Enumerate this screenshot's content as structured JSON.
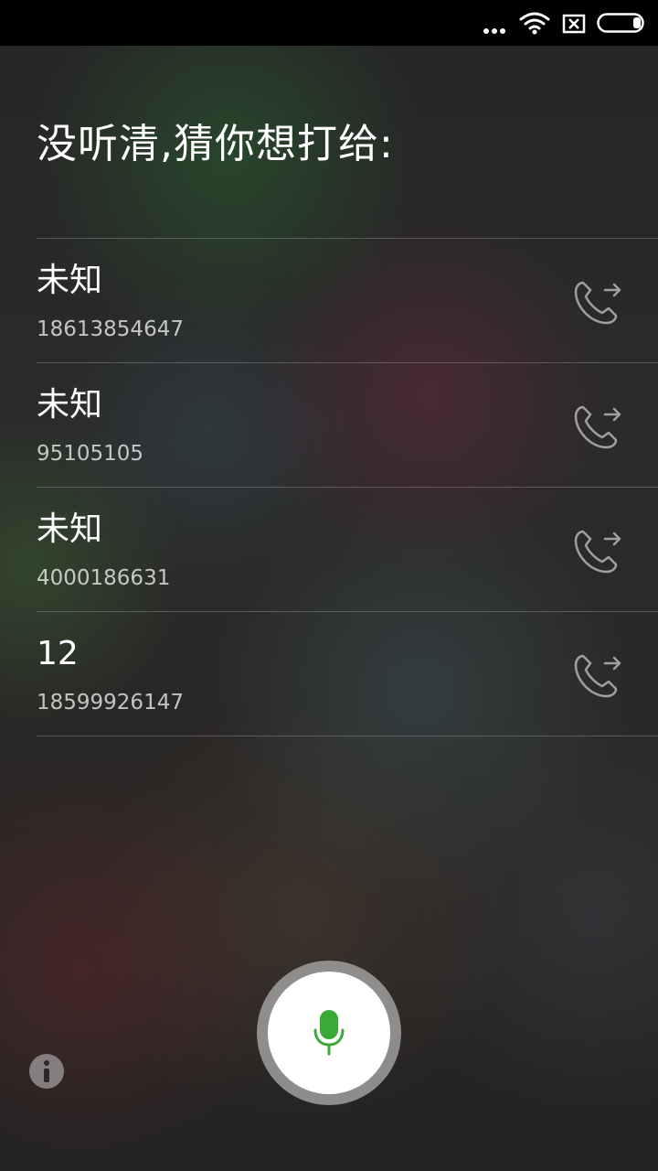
{
  "status_bar": {
    "icons": [
      "more-dots-icon",
      "wifi-icon",
      "no-sim-icon",
      "battery-icon"
    ]
  },
  "prompt": {
    "title": "没听清,猜你想打给:"
  },
  "contacts": [
    {
      "name": "未知",
      "number": "18613854647",
      "action_icon": "call-outgoing-icon"
    },
    {
      "name": "未知",
      "number": "95105105",
      "action_icon": "call-outgoing-icon"
    },
    {
      "name": "未知",
      "number": "4000186631",
      "action_icon": "call-outgoing-icon"
    },
    {
      "name": "12",
      "number": "18599926147",
      "action_icon": "call-outgoing-icon"
    }
  ],
  "voice": {
    "mic_icon": "microphone-icon",
    "info_icon": "info-icon"
  },
  "colors": {
    "mic_accent": "#3aa935",
    "status_bar_bg": "#000000",
    "text_primary": "#ffffff"
  }
}
